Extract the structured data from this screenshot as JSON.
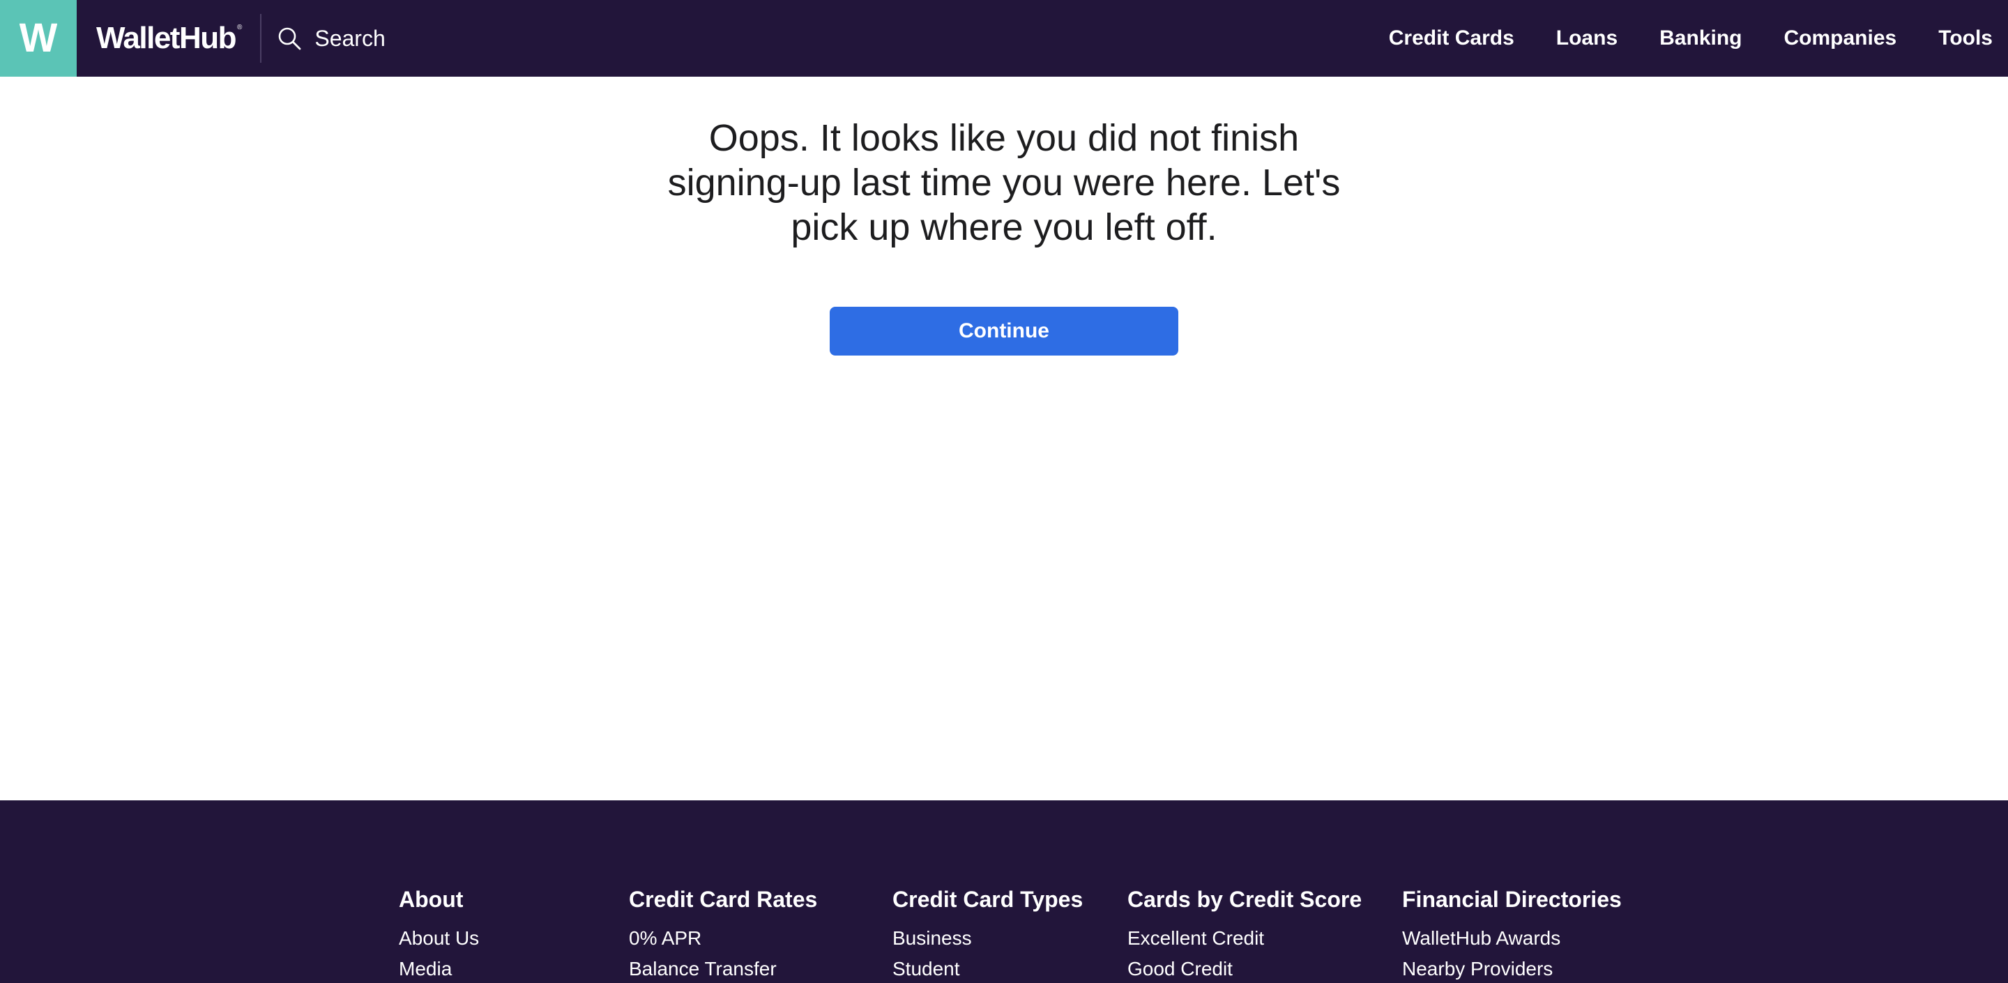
{
  "header": {
    "logo_letter": "W",
    "brand_name": "WalletHub",
    "brand_mark": "®",
    "logo_color": "#5bc4b6",
    "background_color": "#22153a",
    "search": {
      "icon": "search-icon",
      "label": "Search"
    },
    "nav": [
      {
        "label": "Credit Cards"
      },
      {
        "label": "Loans"
      },
      {
        "label": "Banking"
      },
      {
        "label": "Companies"
      },
      {
        "label": "Tools"
      }
    ]
  },
  "main": {
    "message": "Oops. It looks like you did not finish signing-up last time you were here. Let's pick up where you left off.",
    "continue_label": "Continue",
    "button_color": "#2e6de4"
  },
  "footer": {
    "background_color": "#22153a",
    "columns": [
      {
        "heading": "About",
        "links": [
          "About Us",
          "Media"
        ]
      },
      {
        "heading": "Credit Card Rates",
        "links": [
          "0% APR",
          "Balance Transfer"
        ]
      },
      {
        "heading": "Credit Card Types",
        "links": [
          "Business",
          "Student"
        ]
      },
      {
        "heading": "Cards by Credit Score",
        "links": [
          "Excellent Credit",
          "Good Credit"
        ]
      },
      {
        "heading": "Financial Directories",
        "links": [
          "WalletHub Awards",
          "Nearby Providers"
        ]
      }
    ]
  }
}
